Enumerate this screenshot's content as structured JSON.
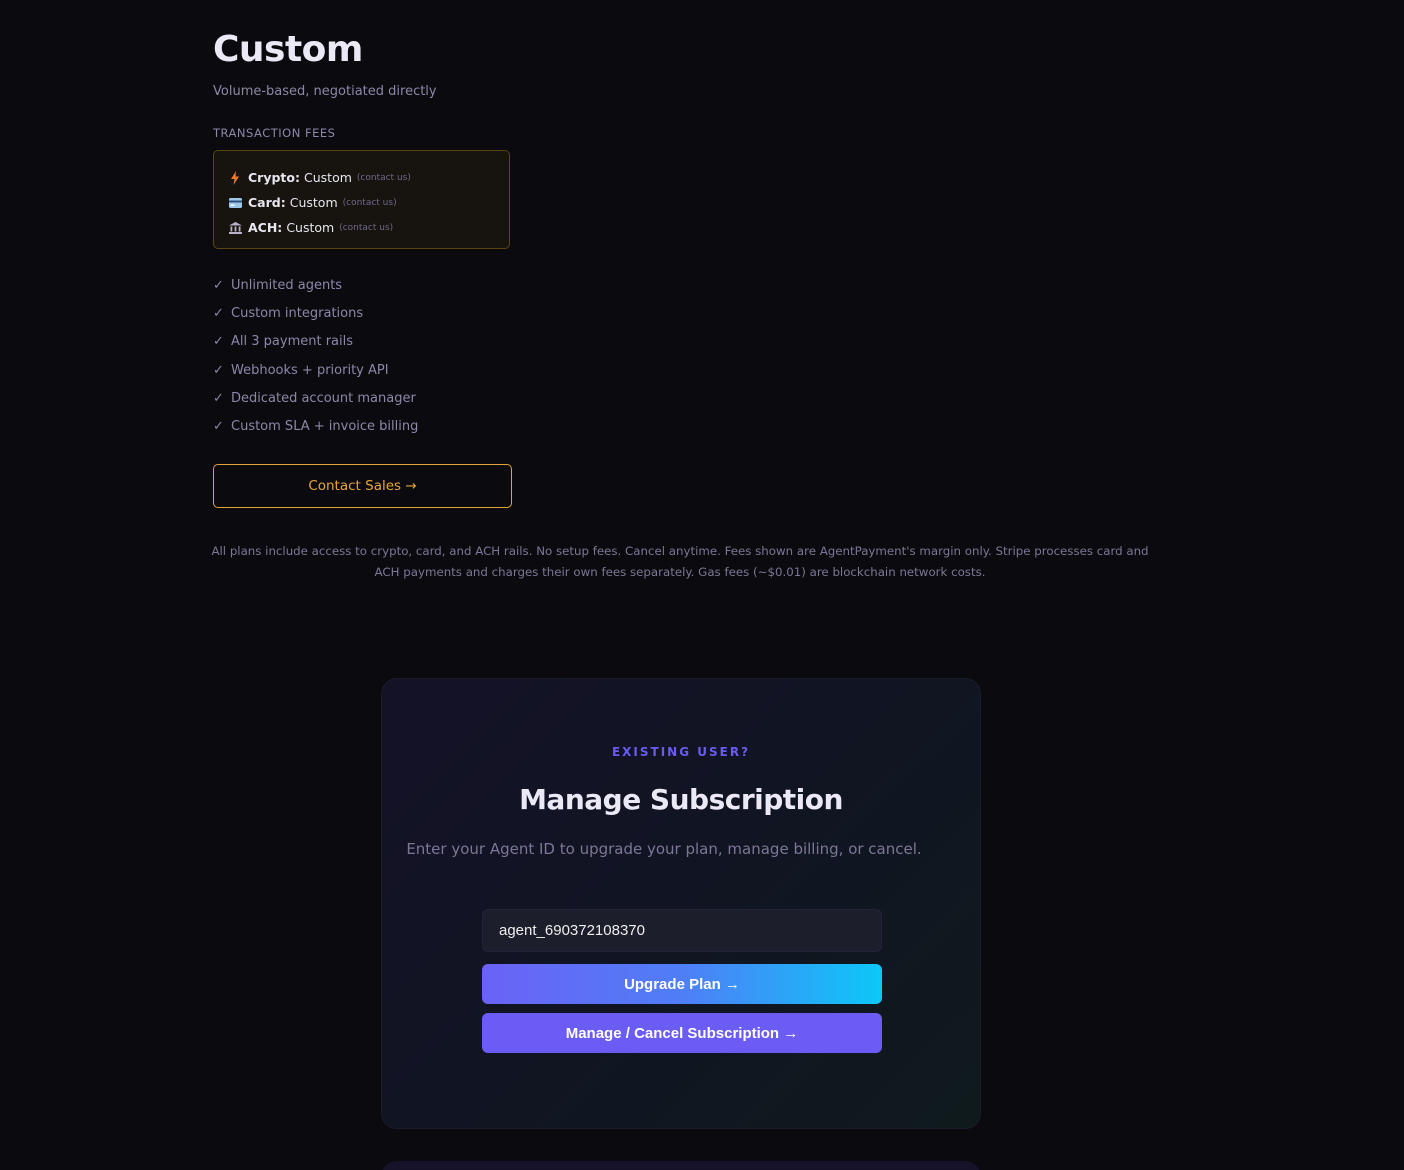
{
  "plan": {
    "name": "Custom",
    "subtitle": "Volume-based, negotiated directly",
    "fees_label": "TRANSACTION FEES",
    "fees": [
      {
        "icon": "lightning-icon",
        "name": "Crypto:",
        "value": "Custom",
        "note": "(contact us)"
      },
      {
        "icon": "credit-card-icon",
        "name": "Card:",
        "value": "Custom",
        "note": "(contact us)"
      },
      {
        "icon": "bank-icon",
        "name": "ACH:",
        "value": "Custom",
        "note": "(contact us)"
      }
    ],
    "check_glyph": "✓",
    "features": [
      "Unlimited agents",
      "Custom integrations",
      "All 3 payment rails",
      "Webhooks + priority API",
      "Dedicated account manager",
      "Custom SLA + invoice billing"
    ],
    "cta_label": "Contact Sales →"
  },
  "footnote": "All plans include access to crypto, card, and ACH rails. No setup fees. Cancel anytime. Fees shown are AgentPayment's margin only. Stripe processes card and ACH payments and charges their own fees separately. Gas fees (~$0.01) are blockchain network costs.",
  "manage": {
    "eyebrow": "EXISTING USER?",
    "title": "Manage Subscription",
    "description": "Enter your Agent ID to upgrade your plan, manage billing, or cancel.",
    "agent_id_value": "agent_690372108370",
    "upgrade_label": "Upgrade Plan →",
    "manage_label": "Manage / Cancel Subscription →"
  },
  "colors": {
    "background": "#0b0a0f",
    "accent_orange": "#e8a63a",
    "accent_purple": "#6b5cf5",
    "accent_cyan": "#0cc8f7"
  }
}
